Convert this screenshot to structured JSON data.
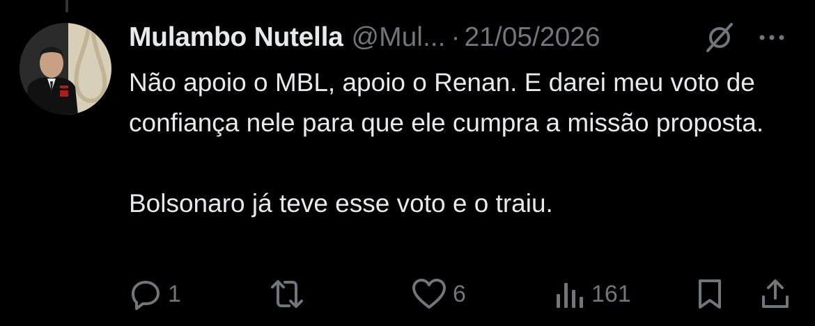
{
  "tweet": {
    "author": {
      "display_name": "Mulambo Nutella",
      "handle": "@Mul...",
      "avatar_icon": "avatar-photo"
    },
    "separator": "·",
    "timestamp": "21/05/2026",
    "text_paragraphs": [
      "Não apoio o MBL, apoio o Renan. E darei meu voto de confiança nele para que ele cumpra a missão proposta.",
      "Bolsonaro já teve esse voto e o traiu."
    ],
    "header_icons": [
      "grok-icon",
      "more-icon"
    ],
    "actions": {
      "reply": {
        "icon": "reply-icon",
        "count": "1"
      },
      "repost": {
        "icon": "repost-icon",
        "count": ""
      },
      "like": {
        "icon": "heart-icon",
        "count": "6"
      },
      "views": {
        "icon": "views-icon",
        "count": "161"
      },
      "bookmark": {
        "icon": "bookmark-icon"
      },
      "share": {
        "icon": "share-icon"
      }
    }
  },
  "colors": {
    "background": "#000000",
    "primary_text": "#e7e9ea",
    "secondary_text": "#71767b"
  }
}
